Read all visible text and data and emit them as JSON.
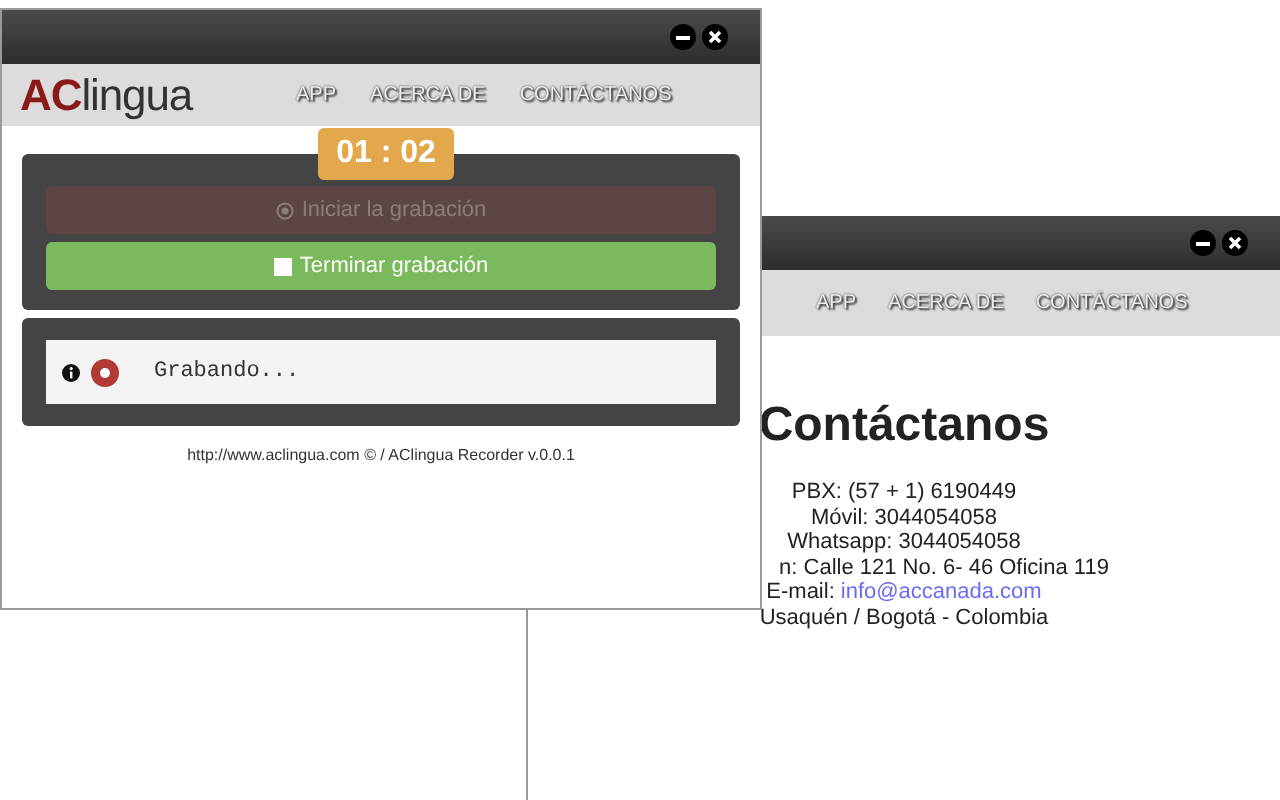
{
  "recorder_window": {
    "logo": {
      "prefix": "AC",
      "suffix": "lingua"
    },
    "nav": [
      "APP",
      "ACERCA DE",
      "CONTÁCTANOS"
    ],
    "timer": "01 : 02",
    "buttons": [
      {
        "label": "Iniciar la grabación",
        "kind": "start",
        "disabled": true
      },
      {
        "label": "Terminar grabación",
        "kind": "stop",
        "disabled": false
      }
    ],
    "status": {
      "text": "Grabando...",
      "recording": true
    },
    "footer": "http://www.aclingua.com © / AClingua Recorder v.0.0.1"
  },
  "contact_window": {
    "nav": [
      "APP",
      "ACERCA DE",
      "CONTÁCTANOS"
    ],
    "heading": "Contáctanos",
    "lines": [
      {
        "text": "PBX: (57 + 1) 6190449"
      },
      {
        "text": "Móvil: 3044054058"
      },
      {
        "text": "Whatsapp: 3044054058"
      },
      {
        "text": "n: Calle 121 No. 6- 46 Oficina 119",
        "kind": "cut"
      },
      {
        "text": "E-mail:",
        "link": "info@accanada.com"
      },
      {
        "text": "Usaquén / Bogotá - Colombia"
      }
    ]
  }
}
